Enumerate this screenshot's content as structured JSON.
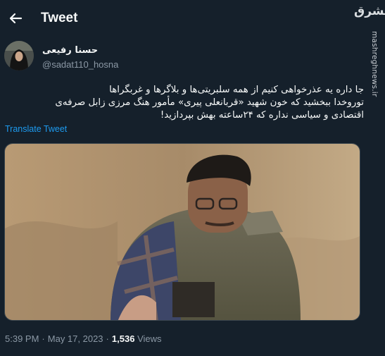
{
  "header": {
    "title": "Tweet",
    "back_icon": "arrow-left-icon"
  },
  "watermark": {
    "logo_text": "مشرق",
    "url": "mashreghnews.ir"
  },
  "author": {
    "display_name": "حسنا رفیعی",
    "username": "@sadat110_hosna"
  },
  "tweet": {
    "lines": [
      "جا داره یه عذرخواهی کنیم از همه سلبریتی‌ها و بلاگرها و غربگراها",
      "توروخدا ببخشید که خون شهید «قربانعلی پیری» مأمور هنگ مرزی زابل صرفه‌ی",
      "اقتصادی و سیاسی نداره که ۲۴ساعته بهش بپردازید!"
    ],
    "translate_label": "Translate Tweet"
  },
  "meta": {
    "time": "5:39 PM",
    "separator": "·",
    "date": "May 17, 2023",
    "views_count": "1,536",
    "views_label": "Views"
  },
  "colors": {
    "background": "#15202b",
    "text": "#f7f9f9",
    "secondary": "#8b98a5",
    "link": "#1d9bf0",
    "border": "#38444d"
  }
}
